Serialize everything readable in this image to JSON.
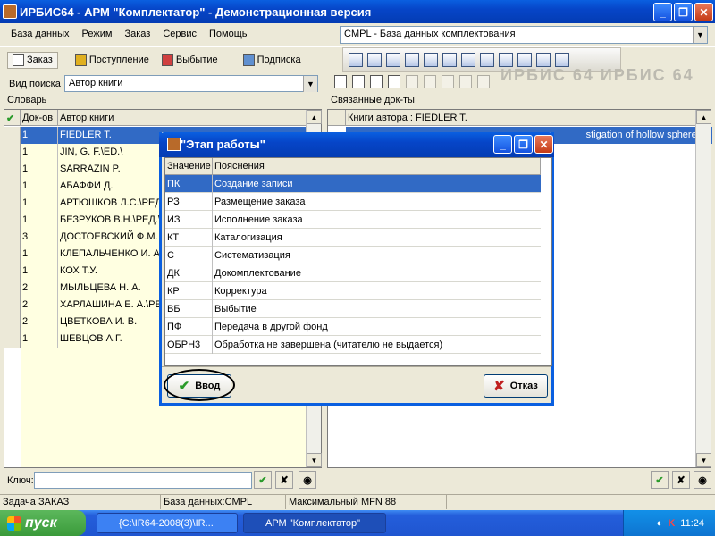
{
  "window": {
    "title": "ИРБИС64 - АРМ \"Комплектатор\" - Демонстрационная версия",
    "min": "_",
    "max": "❐",
    "close": "✕"
  },
  "menu": [
    "База данных",
    "Режим",
    "Заказ",
    "Сервис",
    "Помощь"
  ],
  "database_combo": "CMPL - База данных комплектования",
  "tabs": [
    "Заказ",
    "Поступление",
    "Выбытие",
    "Подписка"
  ],
  "watermark": "ИРБИС 64     ИРБИС 64",
  "search": {
    "label": "Вид поиска",
    "value": "Автор книги"
  },
  "dictionary": {
    "title": "Словарь",
    "headers": {
      "check": "✔",
      "count": "Док-ов",
      "author": "Автор книги"
    },
    "rows": [
      {
        "count": "1",
        "author": "FIEDLER T."
      },
      {
        "count": "1",
        "author": "JIN, G. F.\\ED.\\"
      },
      {
        "count": "1",
        "author": "SARRAZIN P."
      },
      {
        "count": "1",
        "author": "АБАФФИ Д."
      },
      {
        "count": "1",
        "author": "АРТЮШКОВ Л.С.\\РЕД.\\"
      },
      {
        "count": "1",
        "author": "БЕЗРУКОВ В.Н.\\РЕД.\\"
      },
      {
        "count": "3",
        "author": "ДОСТОЕВСКИЙ Ф.М."
      },
      {
        "count": "1",
        "author": "КЛЕПАЛЬЧЕНКО И. А."
      },
      {
        "count": "1",
        "author": "КОХ Т.У."
      },
      {
        "count": "2",
        "author": "МЫЛЬЦЕВА Н. А."
      },
      {
        "count": "2",
        "author": "ХАРЛАШИНА Е. А.\\РЕД"
      },
      {
        "count": "2",
        "author": "ЦВЕТКОВА И. В."
      },
      {
        "count": "1",
        "author": "ШЕВЦОВ А.Г."
      }
    ]
  },
  "linked": {
    "title": "Связанные док-ты",
    "header": "Книги автора : FIEDLER T.",
    "selected_text": "stigation of hollow sphere str"
  },
  "key": {
    "label": "Ключ:"
  },
  "status": [
    "Задача ЗАКАЗ",
    "База данных:CMPL",
    "Максимальный MFN 88",
    ""
  ],
  "dialog": {
    "title": "\"Этап работы\"",
    "headers": {
      "value": "Значение",
      "desc": "Пояснения"
    },
    "rows": [
      {
        "v": "ПК",
        "d": "Создание записи"
      },
      {
        "v": "РЗ",
        "d": "Размещение заказа"
      },
      {
        "v": "ИЗ",
        "d": "Исполнение заказа"
      },
      {
        "v": "КТ",
        "d": "Каталогизация"
      },
      {
        "v": "С",
        "d": "Систематизация"
      },
      {
        "v": "ДК",
        "d": "Докомплектование"
      },
      {
        "v": "КР",
        "d": "Корректура"
      },
      {
        "v": "ВБ",
        "d": "Выбытие"
      },
      {
        "v": "ПФ",
        "d": "Передача в другой фонд"
      },
      {
        "v": "ОБРН3",
        "d": "Обработка не завершена (читателю не выдается)"
      }
    ],
    "ok": "Ввод",
    "cancel": "Отказ"
  },
  "taskbar": {
    "start": "пуск",
    "task1": "{C:\\IR64-2008(3)\\IR...",
    "task2": "АРМ \"Комплектатор\"",
    "clock": "11:24"
  }
}
